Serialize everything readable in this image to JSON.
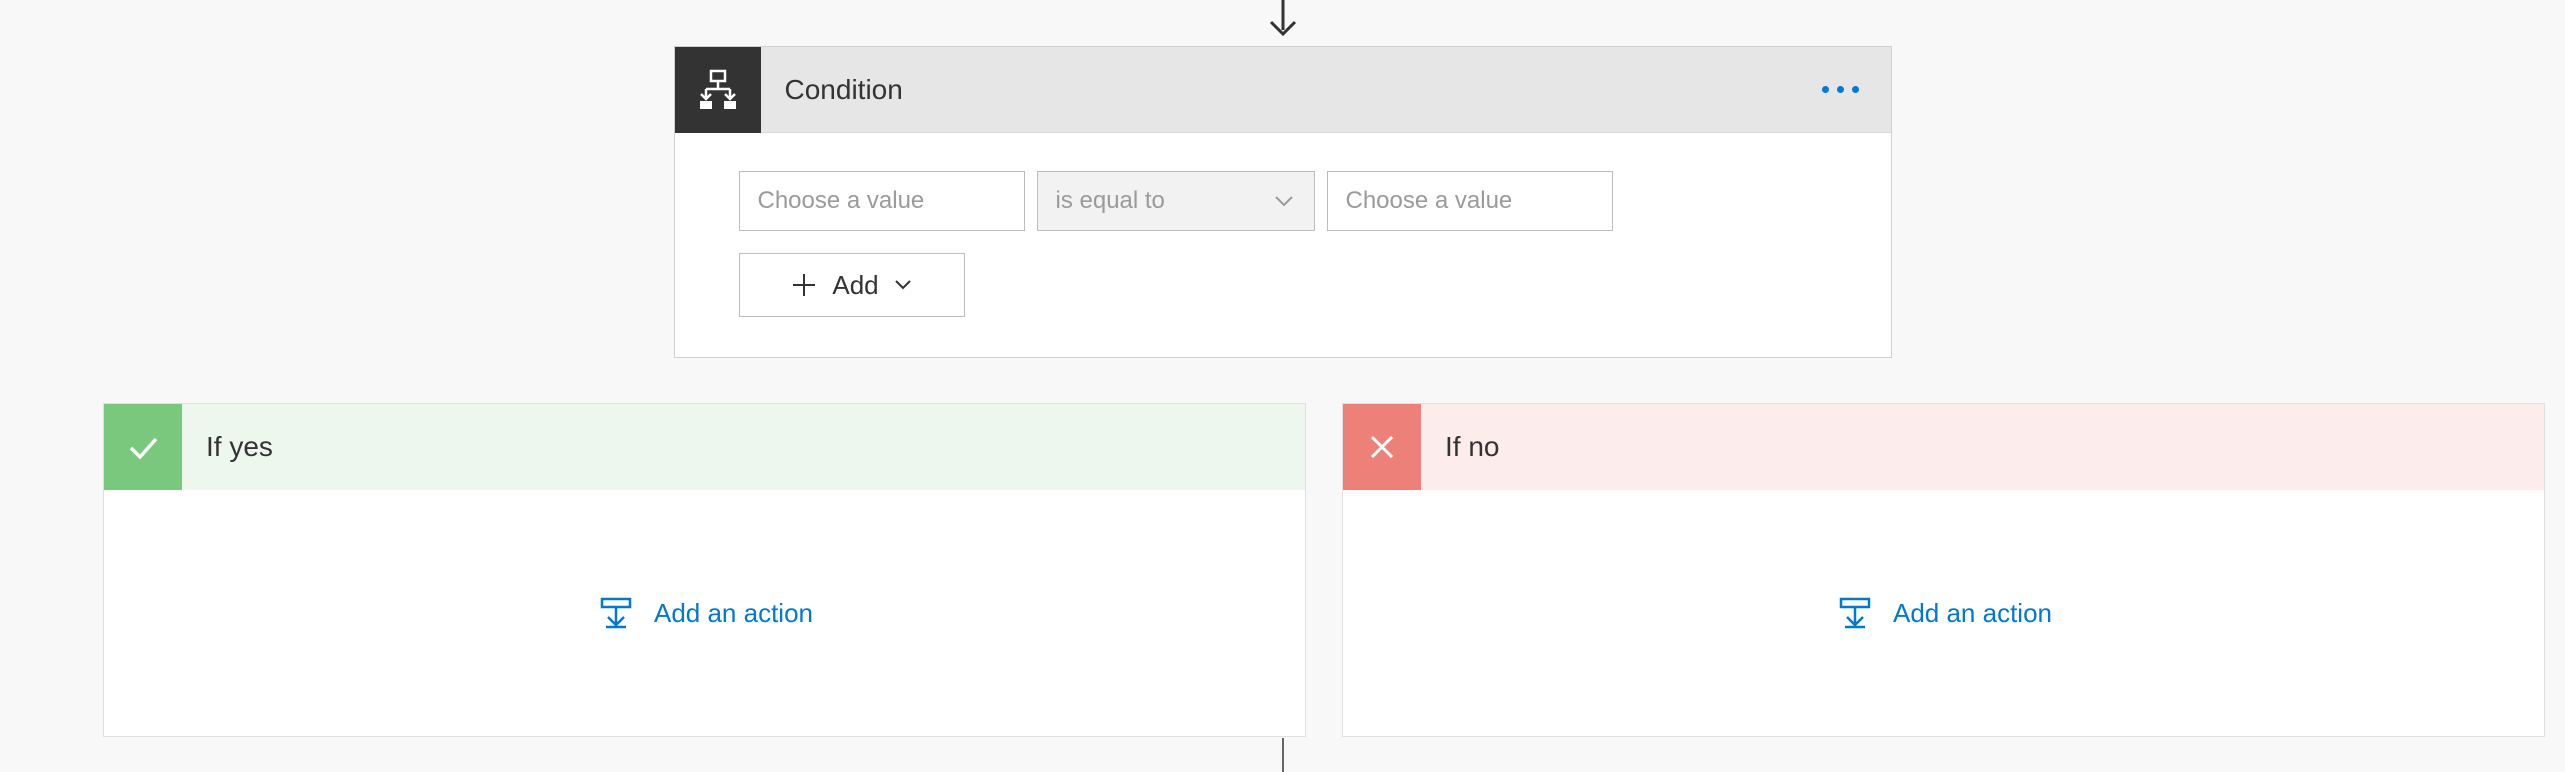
{
  "condition": {
    "title": "Condition",
    "left_placeholder": "Choose a value",
    "operator_label": "is equal to",
    "right_placeholder": "Choose a value",
    "add_label": "Add"
  },
  "branches": {
    "yes": {
      "title": "If yes",
      "add_action_label": "Add an action"
    },
    "no": {
      "title": "If no",
      "add_action_label": "Add an action"
    }
  }
}
